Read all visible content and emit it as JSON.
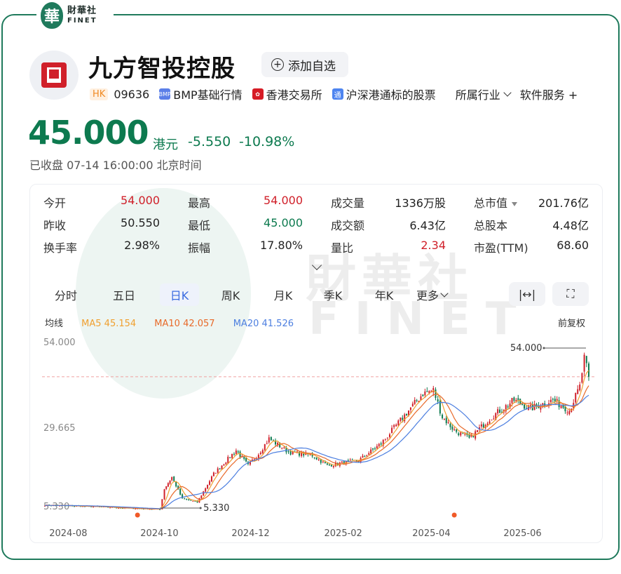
{
  "brand": {
    "seal": "華",
    "name_cn": "財華社",
    "name_en": "FINET"
  },
  "stock": {
    "name": "九方智投控股",
    "watch_label": "添加自选",
    "market_tag": "HK",
    "code": "09636",
    "tags": [
      "BMP基础行情",
      "香港交易所",
      "沪深港通标的股票"
    ],
    "tag_icons": [
      "BMP",
      "hkex-icon",
      "通"
    ],
    "industry_menu": "所属行业",
    "industry": "软件服务",
    "industry_more": "+"
  },
  "quote": {
    "price": "45.000",
    "unit": "港元",
    "change": "-5.550",
    "change_pct": "-10.98%",
    "status": "已收盘",
    "datetime": "07-14 16:00:00",
    "timezone": "北京时间"
  },
  "stats": [
    [
      {
        "label": "今开",
        "value": "54.000",
        "color": "red"
      },
      {
        "label": "最高",
        "value": "54.000",
        "color": "red"
      },
      {
        "label": "成交量",
        "value": "1336万股",
        "color": "dark"
      },
      {
        "label": "总市值",
        "value": "201.76亿",
        "color": "dark",
        "sort": true
      }
    ],
    [
      {
        "label": "昨收",
        "value": "50.550",
        "color": "dark"
      },
      {
        "label": "最低",
        "value": "45.000",
        "color": "green"
      },
      {
        "label": "成交额",
        "value": "6.43亿",
        "color": "dark"
      },
      {
        "label": "总股本",
        "value": "4.48亿",
        "color": "dark"
      }
    ],
    [
      {
        "label": "换手率",
        "value": "2.98%",
        "color": "dark"
      },
      {
        "label": "振幅",
        "value": "17.80%",
        "color": "dark"
      },
      {
        "label": "量比",
        "value": "2.34",
        "color": "red"
      },
      {
        "label": "市盈(TTM)",
        "value": "68.60",
        "color": "dark"
      }
    ]
  ],
  "tabs": [
    "分时",
    "五日",
    "日K",
    "周K",
    "月K",
    "季K",
    "年K",
    "更多"
  ],
  "active_tab": "日K",
  "tools": {
    "fullrange": "|↔|",
    "fullscreen": "⛶"
  },
  "ma": {
    "label": "均线",
    "ma5": "MA5 45.154",
    "ma10": "MA10 42.057",
    "ma20": "MA20 41.526",
    "adjust": "前复权",
    "colors": {
      "ma5": "#f0a030",
      "ma10": "#e86a2a",
      "ma20": "#4d7fe0",
      "up": "#d0202a",
      "down": "#0d7a4f"
    }
  },
  "chart_data": {
    "type": "candlestick",
    "y_ticks": [
      "54.000",
      "29.665",
      "5.330"
    ],
    "ylim": [
      5.33,
      54.0
    ],
    "x_ticks": [
      "2024-08",
      "2024-10",
      "2024-12",
      "2025-02",
      "2025-04",
      "2025-06"
    ],
    "max_label": "54.000",
    "min_label": "5.330",
    "last_close": 45.0,
    "anchors": [
      [
        "2024-07-15",
        6.6
      ],
      [
        "2024-08-15",
        6.2
      ],
      [
        "2024-09-15",
        5.6
      ],
      [
        "2024-09-30",
        5.4
      ],
      [
        "2024-10-03",
        11.5
      ],
      [
        "2024-10-08",
        15.0
      ],
      [
        "2024-10-15",
        8.5
      ],
      [
        "2024-10-25",
        7.5
      ],
      [
        "2024-11-05",
        16.0
      ],
      [
        "2024-11-20",
        23.0
      ],
      [
        "2024-11-28",
        18.5
      ],
      [
        "2024-12-05",
        22.0
      ],
      [
        "2024-12-12",
        26.5
      ],
      [
        "2024-12-25",
        22.5
      ],
      [
        "2025-01-10",
        21.5
      ],
      [
        "2025-01-20",
        18.5
      ],
      [
        "2025-02-10",
        20.0
      ],
      [
        "2025-02-25",
        25.0
      ],
      [
        "2025-03-10",
        32.0
      ],
      [
        "2025-03-25",
        40.0
      ],
      [
        "2025-04-01",
        41.0
      ],
      [
        "2025-04-07",
        33.0
      ],
      [
        "2025-04-15",
        29.0
      ],
      [
        "2025-04-25",
        26.5
      ],
      [
        "2025-05-10",
        33.0
      ],
      [
        "2025-05-25",
        38.0
      ],
      [
        "2025-06-05",
        35.5
      ],
      [
        "2025-06-20",
        38.0
      ],
      [
        "2025-07-01",
        35.0
      ],
      [
        "2025-07-08",
        42.0
      ],
      [
        "2025-07-11",
        50.5
      ],
      [
        "2025-07-14",
        45.0
      ]
    ]
  }
}
